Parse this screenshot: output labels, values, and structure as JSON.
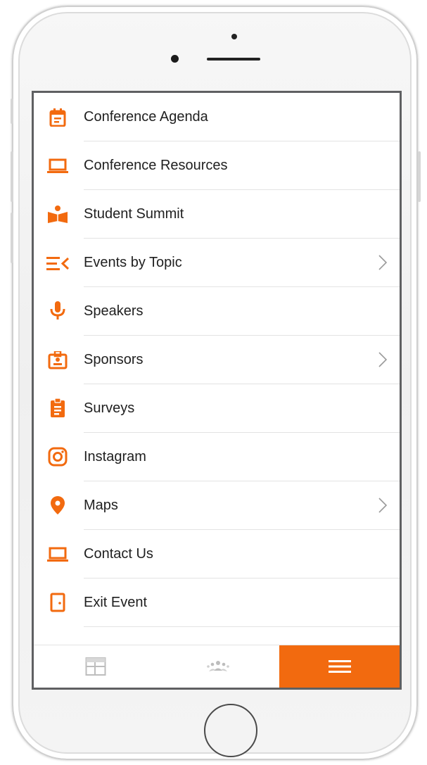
{
  "colors": {
    "accent": "#f26a0f",
    "text": "#1f1f1f",
    "divider": "#e3e3e3",
    "tab_inactive": "#bdbdbd"
  },
  "menu": {
    "items": [
      {
        "label": "Conference Agenda",
        "icon": "calendar-icon",
        "has_chevron": false
      },
      {
        "label": "Conference Resources",
        "icon": "laptop-icon",
        "has_chevron": false
      },
      {
        "label": "Student Summit",
        "icon": "student-reading-icon",
        "has_chevron": false
      },
      {
        "label": "Events by Topic",
        "icon": "topic-list-icon",
        "has_chevron": true
      },
      {
        "label": "Speakers",
        "icon": "microphone-icon",
        "has_chevron": false
      },
      {
        "label": "Sponsors",
        "icon": "badge-icon",
        "has_chevron": true
      },
      {
        "label": "Surveys",
        "icon": "clipboard-icon",
        "has_chevron": false
      },
      {
        "label": "Instagram",
        "icon": "instagram-icon",
        "has_chevron": false
      },
      {
        "label": "Maps",
        "icon": "map-pin-icon",
        "has_chevron": true
      },
      {
        "label": "Contact Us",
        "icon": "laptop-icon",
        "has_chevron": false
      },
      {
        "label": "Exit Event",
        "icon": "exit-door-icon",
        "has_chevron": false
      }
    ]
  },
  "tabbar": {
    "tabs": [
      {
        "icon": "schedule-icon",
        "active": false
      },
      {
        "icon": "attendees-icon",
        "active": false
      },
      {
        "icon": "hamburger-menu-icon",
        "active": true
      }
    ]
  }
}
